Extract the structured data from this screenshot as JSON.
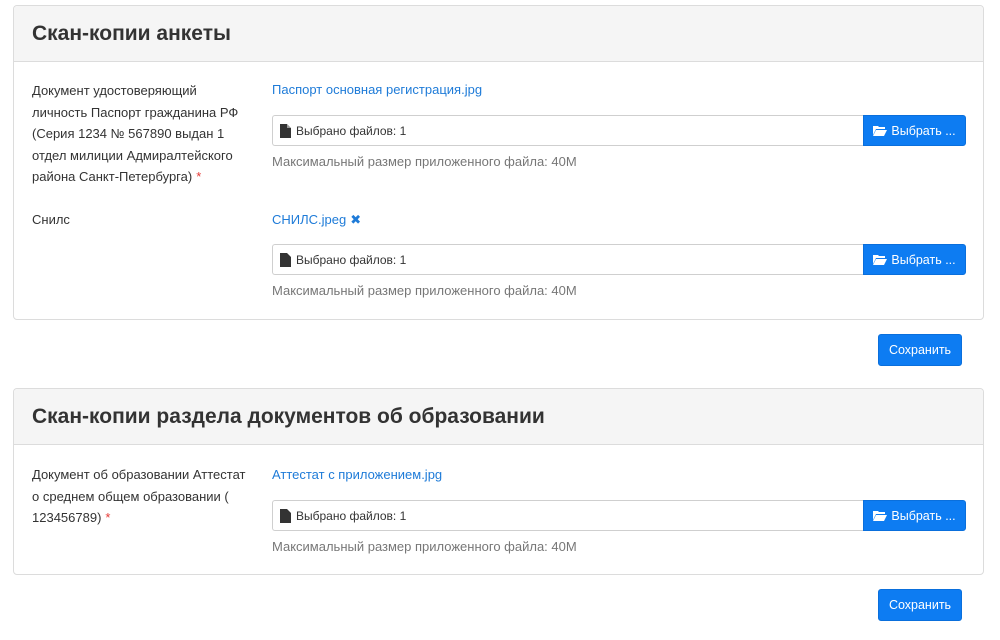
{
  "section1": {
    "title": "Скан-копии анкеты",
    "items": [
      {
        "label": "Документ удостоверяющий личность Паспорт гражданина РФ (Серия 1234 № 567890 выдан 1 отдел милиции Адмиралтейского района Санкт-Петербурга)",
        "required_mark": "*",
        "file_name": "Паспорт основная регистрация.jpg",
        "file_status": "Выбрано файлов: 1",
        "browse_label": "Выбрать ...",
        "hint": "Максимальный размер приложенного файла: 40M"
      },
      {
        "label": "Снилс",
        "file_name": "СНИЛС.jpeg",
        "remove_mark": "✖",
        "file_status": "Выбрано файлов: 1",
        "browse_label": "Выбрать ...",
        "hint": "Максимальный размер приложенного файла: 40M"
      }
    ],
    "save_label": "Сохранить"
  },
  "section2": {
    "title": "Скан-копии раздела документов об образовании",
    "items": [
      {
        "label": "Документ об образовании Аттестат о среднем общем образовании ( 123456789)",
        "required_mark": "*",
        "file_name": "Аттестат с приложением.jpg",
        "file_status": "Выбрано файлов: 1",
        "browse_label": "Выбрать ...",
        "hint": "Максимальный размер приложенного файла: 40M"
      }
    ],
    "save_label": "Сохранить"
  },
  "icons": {
    "file": "file-icon",
    "folder": "folder-open-icon",
    "remove": "close-icon"
  },
  "colors": {
    "primary": "#0d7cf2",
    "link": "#1e7bd8",
    "required": "#e53935",
    "hint": "#777777"
  }
}
